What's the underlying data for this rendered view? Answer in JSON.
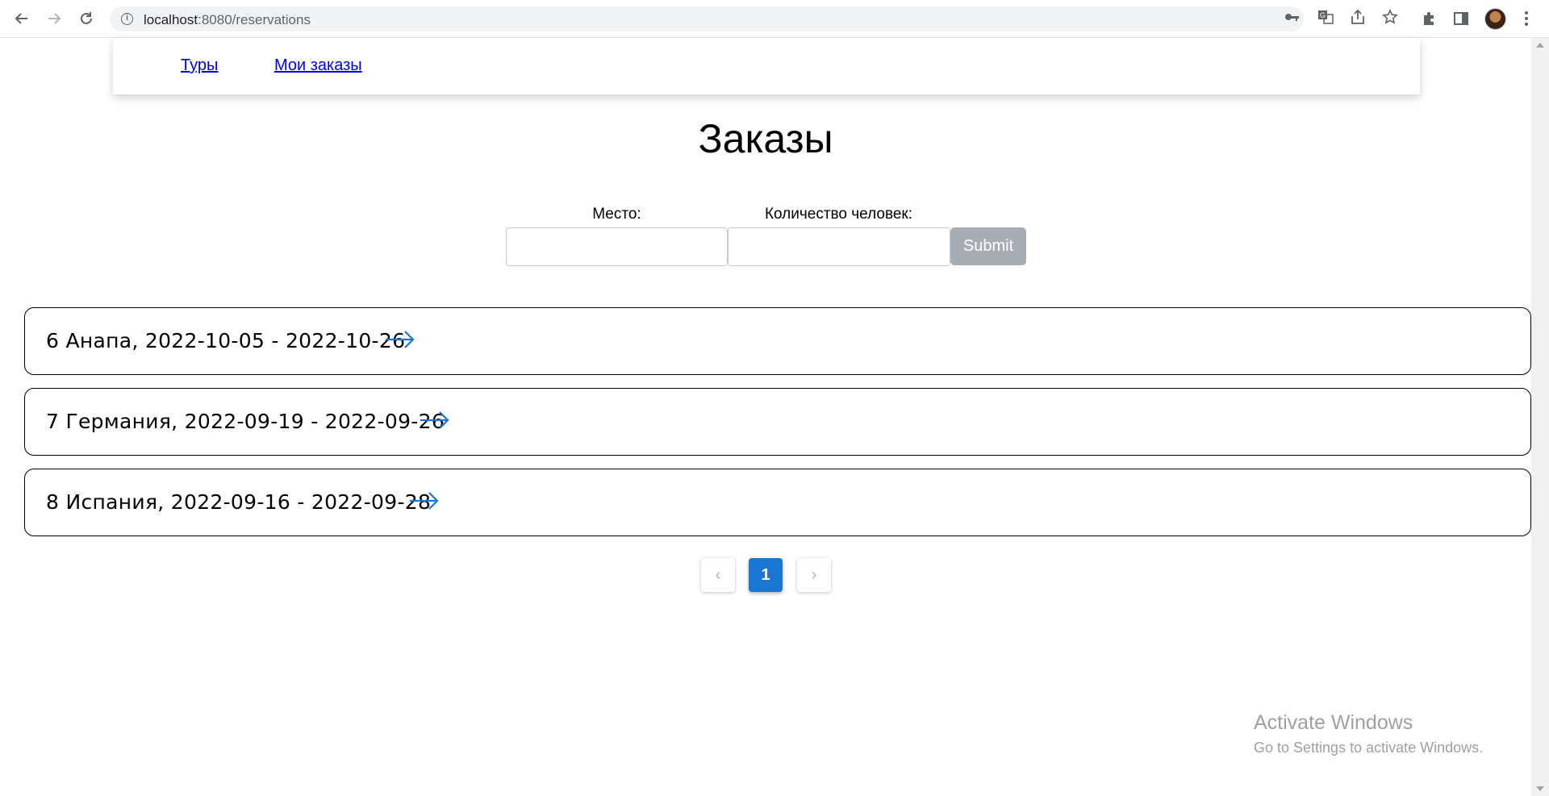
{
  "browser": {
    "url_host": "localhost",
    "url_path": ":8080/reservations",
    "icons": [
      "back-icon",
      "forward-icon",
      "reload-icon",
      "info-icon",
      "key-icon",
      "translate-icon",
      "share-icon",
      "star-icon",
      "extensions-icon",
      "side-panel-icon",
      "avatar",
      "menu-icon"
    ]
  },
  "nav": {
    "tours_label": "Туры",
    "orders_label": "Мои заказы"
  },
  "page": {
    "title": "Заказы"
  },
  "filter": {
    "place_label": "Место:",
    "place_value": "",
    "people_label": "Количество человек:",
    "people_value": "",
    "submit_label": "Submit"
  },
  "reservations": [
    {
      "label": "6 Анапа, 2022-10-05 - 2022-10-26"
    },
    {
      "label": "7 Германия, 2022-09-19 - 2022-09-26"
    },
    {
      "label": "8 Испания, 2022-09-16 - 2022-09-28"
    }
  ],
  "pagination": {
    "prev": "‹",
    "current": "1",
    "next": "›"
  },
  "watermark": {
    "line1": "Activate Windows",
    "line2": "Go to Settings to activate Windows."
  },
  "colors": {
    "accent": "#1976d2",
    "link": "#0000ee",
    "submit_disabled": "#a8adb3"
  }
}
